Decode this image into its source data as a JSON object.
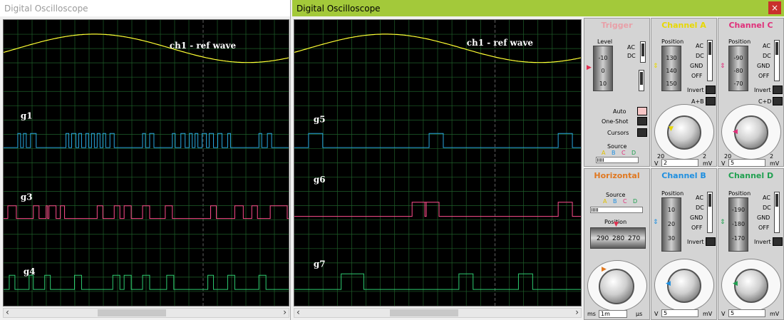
{
  "window1": {
    "title": "Digital Oscilloscope",
    "ref_label": "ch1 - ref wave",
    "labels": [
      "g1",
      "g3",
      "g4"
    ]
  },
  "window2": {
    "title": "Digital Oscilloscope",
    "close": "×",
    "ref_label": "ch1 - ref wave",
    "labels": [
      "g5",
      "g6",
      "g7"
    ]
  },
  "colors": {
    "wave_yellow": "#ffff33",
    "wave_blue": "#29a8e0",
    "wave_pink": "#ff4d8c",
    "wave_green": "#2ecc71",
    "grid": "#1f5f2a"
  },
  "trigger": {
    "title": "Trigger",
    "level_label": "Level",
    "level_ticks": [
      "-10",
      "0",
      "10"
    ],
    "ac": "AC",
    "dc": "DC",
    "auto": "Auto",
    "oneshot": "One-Shot",
    "cursors": "Cursors",
    "source_label": "Source",
    "source_letters": [
      "A",
      "B",
      "C",
      "D"
    ]
  },
  "channelA": {
    "title": "Channel A",
    "position_label": "Position",
    "ticks": [
      "130",
      "140",
      "150"
    ],
    "ac": "AC",
    "dc": "DC",
    "gnd": "GND",
    "off": "OFF",
    "invert": "Invert",
    "combo": "A+B",
    "value": "2",
    "unit": "mV",
    "v": "V",
    "left_scale": [
      "20"
    ],
    "right_scale": [
      "2"
    ]
  },
  "channelC": {
    "title": "Channel C",
    "position_label": "Position",
    "ticks": [
      "-90",
      "-80",
      "-70"
    ],
    "ac": "AC",
    "dc": "DC",
    "gnd": "GND",
    "off": "OFF",
    "invert": "Invert",
    "combo": "C+D",
    "value": "5",
    "unit": "mV",
    "v": "V",
    "left_scale": [
      "20"
    ],
    "right_scale": [
      "2"
    ]
  },
  "horizontal": {
    "title": "Horizontal",
    "source_label": "Source",
    "source_letters": [
      "A",
      "B",
      "C",
      "D"
    ],
    "position_label": "Position",
    "ticks": [
      "290",
      "280",
      "270"
    ],
    "value": "1m",
    "unit_left": "ms",
    "unit_right": "μs"
  },
  "channelB": {
    "title": "Channel B",
    "position_label": "Position",
    "ticks": [
      "10",
      "20",
      "30"
    ],
    "ac": "AC",
    "dc": "DC",
    "gnd": "GND",
    "off": "OFF",
    "invert": "Invert",
    "value": "5",
    "unit": "mV",
    "v": "V"
  },
  "channelD": {
    "title": "Channel D",
    "position_label": "Position",
    "ticks": [
      "-190",
      "-180",
      "-170"
    ],
    "ac": "AC",
    "dc": "DC",
    "gnd": "GND",
    "off": "OFF",
    "invert": "Invert",
    "value": "5",
    "unit": "mV",
    "v": "V"
  }
}
